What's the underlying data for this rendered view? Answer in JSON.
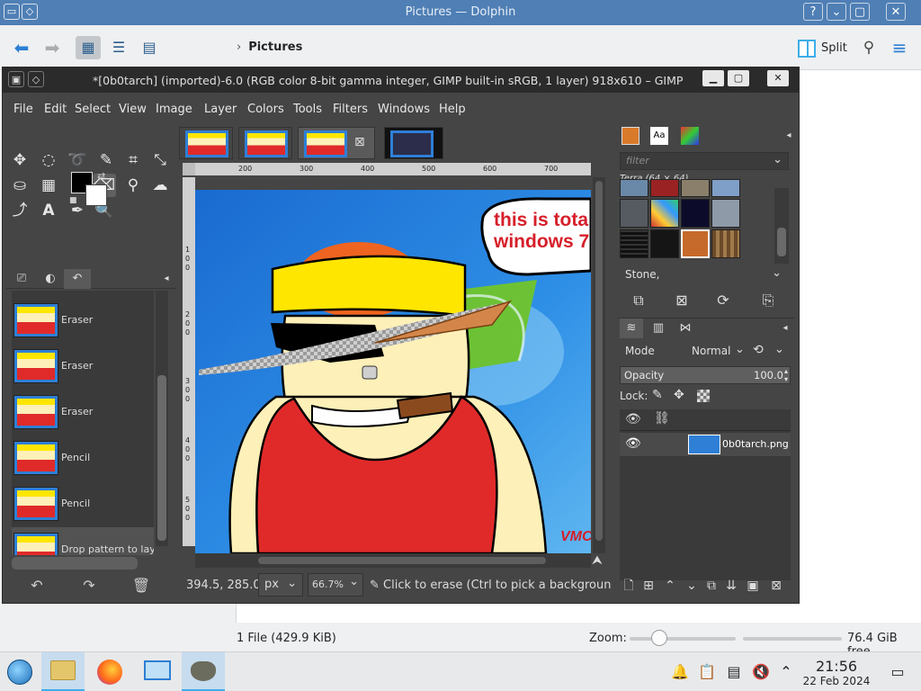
{
  "dolphin": {
    "title": "Pictures — Dolphin",
    "breadcrumb": "Pictures",
    "split_label": "Split",
    "status_files": "1 File (429.9 KiB)",
    "zoom_label": "Zoom:",
    "free_space": "76.4 GiB free"
  },
  "gimp": {
    "title": "*[0b0tarch] (imported)-6.0 (RGB color 8-bit gamma integer, GIMP built-in sRGB, 1 layer) 918x610 – GIMP",
    "menu": [
      "File",
      "Edit",
      "Select",
      "View",
      "Image",
      "Layer",
      "Colors",
      "Tools",
      "Filters",
      "Windows",
      "Help"
    ],
    "history": [
      {
        "label": "Eraser"
      },
      {
        "label": "Eraser"
      },
      {
        "label": "Eraser"
      },
      {
        "label": "Pencil"
      },
      {
        "label": "Pencil"
      },
      {
        "label": "Drop pattern to lay"
      }
    ],
    "ruler_top": [
      "200",
      "300",
      "400",
      "500",
      "600",
      "700"
    ],
    "ruler_left": [
      "1",
      "0",
      "0",
      "2",
      "0",
      "0",
      "3",
      "0",
      "0",
      "4",
      "0",
      "0",
      "5",
      "0",
      "0"
    ],
    "speech_line1": "this is tota",
    "speech_line2": "windows 7",
    "signature": "VMC",
    "status": {
      "coords": "394.5, 285.0",
      "unit": "px",
      "zoom": "66.7%",
      "message": "Click to erase (Ctrl to pick a backgroun..."
    },
    "patterns": {
      "filter_placeholder": "filter",
      "current": "Terra (64 × 64)",
      "tag": "Stone,"
    },
    "layers": {
      "mode_label": "Mode",
      "mode_value": "Normal",
      "opacity_label": "Opacity",
      "opacity_value": "100.0",
      "lock_label": "Lock:",
      "layer_name": "0b0tarch.png"
    }
  },
  "taskbar": {
    "time": "21:56",
    "date": "22 Feb 2024"
  },
  "colors": {
    "accent": "#3daee9",
    "gimp_bg": "#454545",
    "fg_color": "#000000",
    "bg_color": "#ffffff"
  }
}
